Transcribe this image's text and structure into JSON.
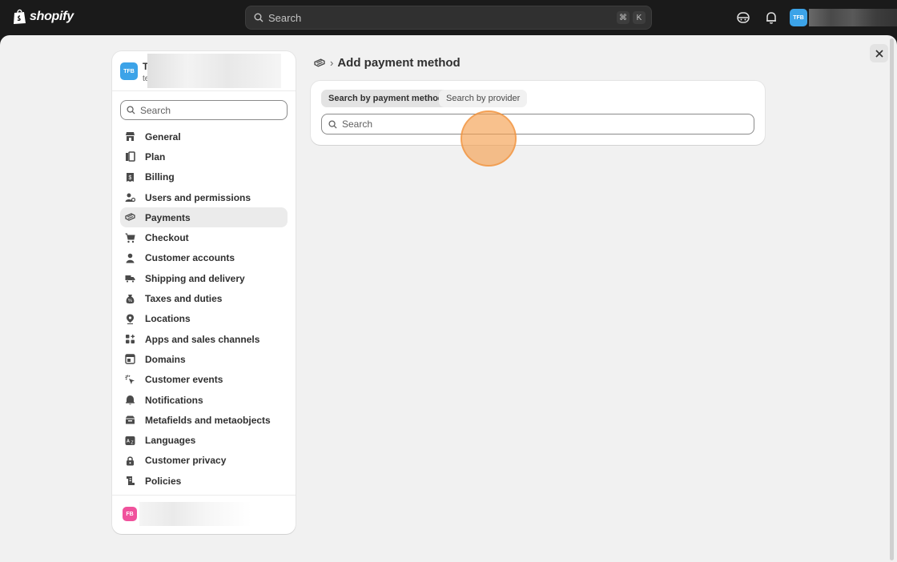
{
  "topbar": {
    "logo_text": "shopify",
    "search_label": "Search",
    "kbd_cmd": "⌘",
    "kbd_k": "K",
    "avatar_initials": "TFB"
  },
  "sidebar": {
    "store_avatar": "TFB",
    "store_name": "T",
    "store_sub": "te",
    "search_placeholder": "Search",
    "items": [
      {
        "label": "General",
        "icon": "store-icon"
      },
      {
        "label": "Plan",
        "icon": "plan-icon"
      },
      {
        "label": "Billing",
        "icon": "billing-icon"
      },
      {
        "label": "Users and permissions",
        "icon": "users-icon"
      },
      {
        "label": "Payments",
        "icon": "payments-icon",
        "active": true
      },
      {
        "label": "Checkout",
        "icon": "cart-icon"
      },
      {
        "label": "Customer accounts",
        "icon": "person-icon"
      },
      {
        "label": "Shipping and delivery",
        "icon": "truck-icon"
      },
      {
        "label": "Taxes and duties",
        "icon": "tax-icon"
      },
      {
        "label": "Locations",
        "icon": "location-icon"
      },
      {
        "label": "Apps and sales channels",
        "icon": "apps-icon"
      },
      {
        "label": "Domains",
        "icon": "domains-icon"
      },
      {
        "label": "Customer events",
        "icon": "cursor-icon"
      },
      {
        "label": "Notifications",
        "icon": "bell-icon"
      },
      {
        "label": "Metafields and metaobjects",
        "icon": "metafields-icon"
      },
      {
        "label": "Languages",
        "icon": "language-icon"
      },
      {
        "label": "Customer privacy",
        "icon": "lock-icon"
      },
      {
        "label": "Policies",
        "icon": "policies-icon"
      }
    ],
    "footer_avatar": "FB"
  },
  "main": {
    "breadcrumb_sep": "›",
    "title": "Add payment method",
    "tabs": [
      "Search by payment method",
      "Search by provider"
    ],
    "search_placeholder": "Search"
  },
  "colors": {
    "accent_avatar": "#3ca3e8",
    "footer_avatar": "#f0529c",
    "click_marker": "#f5a050"
  }
}
